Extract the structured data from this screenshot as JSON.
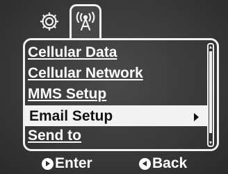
{
  "tabs": [
    {
      "icon": "gear-icon",
      "selected": false
    },
    {
      "icon": "antenna-icon",
      "selected": true
    }
  ],
  "menu": {
    "items": [
      {
        "label": "Cellular Data",
        "selected": false
      },
      {
        "label": "Cellular Network",
        "selected": false
      },
      {
        "label": "MMS Setup",
        "selected": false
      },
      {
        "label": "Email Setup",
        "selected": true,
        "has_submenu": true
      },
      {
        "label": "Send to",
        "selected": false
      }
    ]
  },
  "soft_keys": {
    "enter_label": "Enter",
    "back_label": "Back"
  },
  "colors": {
    "background": "#3c3c3c",
    "foreground": "#f0f0f0",
    "selected_text": "#111111"
  }
}
